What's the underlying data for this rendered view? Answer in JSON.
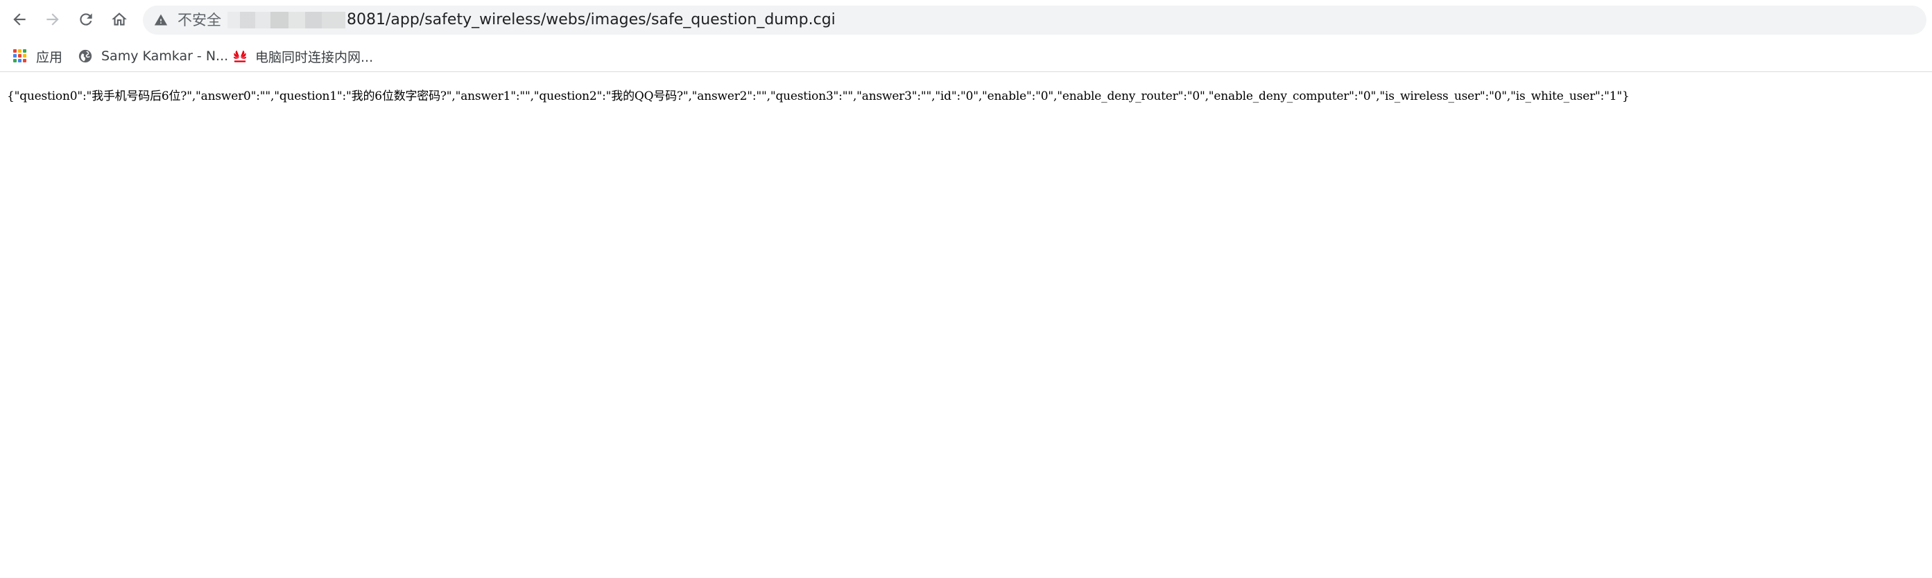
{
  "toolbar": {
    "icons": {
      "back": "arrow-left-icon",
      "forward": "arrow-right-icon",
      "reload": "reload-icon",
      "home": "home-icon"
    },
    "omnibox": {
      "security_icon": "warning-triangle-icon",
      "security_label": "不安全",
      "url_visible": "8081/app/safety_wireless/webs/images/safe_question_dump.cgi"
    }
  },
  "bookmarks": {
    "items": [
      {
        "label": "应用",
        "icon": "apps-grid-icon"
      },
      {
        "label": "Samy Kamkar - N...",
        "icon": "globe-icon"
      },
      {
        "label": "电脑同时连接内网...",
        "icon": "huawei-logo-icon"
      }
    ]
  },
  "page": {
    "body_text": "{\"question0\":\"我手机号码后6位?\",\"answer0\":\"\",\"question1\":\"我的6位数字密码?\",\"answer1\":\"\",\"question2\":\"我的QQ号码?\",\"answer2\":\"\",\"question3\":\"\",\"answer3\":\"\",\"id\":\"0\",\"enable\":\"0\",\"enable_deny_router\":\"0\",\"enable_deny_computer\":\"0\",\"is_wireless_user\":\"0\",\"is_white_user\":\"1\"}"
  },
  "colors": {
    "omnibox_bg": "#f1f3f4",
    "icon_gray": "#5f6368",
    "huawei_red": "#e60012"
  }
}
